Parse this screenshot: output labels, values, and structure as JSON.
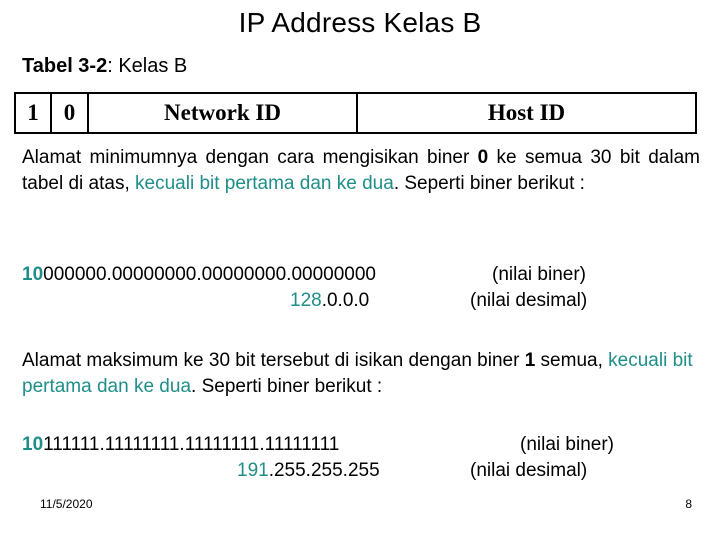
{
  "slide": {
    "title": "IP Address Kelas B",
    "table_caption": {
      "strong": "Tabel 3-2",
      "rest": ": Kelas B"
    },
    "bit_table": {
      "cells": [
        {
          "label": "1"
        },
        {
          "label": "0"
        },
        {
          "label": "Network ID"
        },
        {
          "label": "Host ID"
        }
      ]
    },
    "paragraph_1": {
      "part_a": "Alamat minimumnya dengan cara mengisikan biner ",
      "bold_b": "0",
      "part_c": " ke semua 30 bit dalam tabel di atas, ",
      "teal_d": "kecuali bit pertama dan ke dua",
      "part_e": ". Seperti biner berikut :"
    },
    "binary_block_min": {
      "binary_prefix": "10",
      "binary_rest": "000000.00000000.00000000.00000000",
      "binary_note": "(nilai biner)",
      "decimal_prefix": "128",
      "decimal_rest": ".0.0.0",
      "decimal_note": "(nilai desimal)"
    },
    "paragraph_2": {
      "part_a": "Alamat maksimum ke 30 bit tersebut di isikan dengan biner ",
      "bold_b": "1",
      "part_c": " semua, ",
      "teal_d": "kecuali bit pertama dan ke dua",
      "part_e": ". Seperti biner berikut :"
    },
    "binary_block_max": {
      "binary_prefix": "10",
      "binary_rest": "111111.11111111.11111111.11111111",
      "binary_note": "(nilai biner)",
      "decimal_prefix": "191",
      "decimal_rest": ".255.255.255",
      "decimal_note": "(nilai desimal)"
    },
    "footer": {
      "date": "11/5/2020",
      "page_number": "8"
    },
    "colors": {
      "accent_teal": "#1f8e89",
      "text_black": "#000000",
      "background": "#ffffff"
    }
  }
}
